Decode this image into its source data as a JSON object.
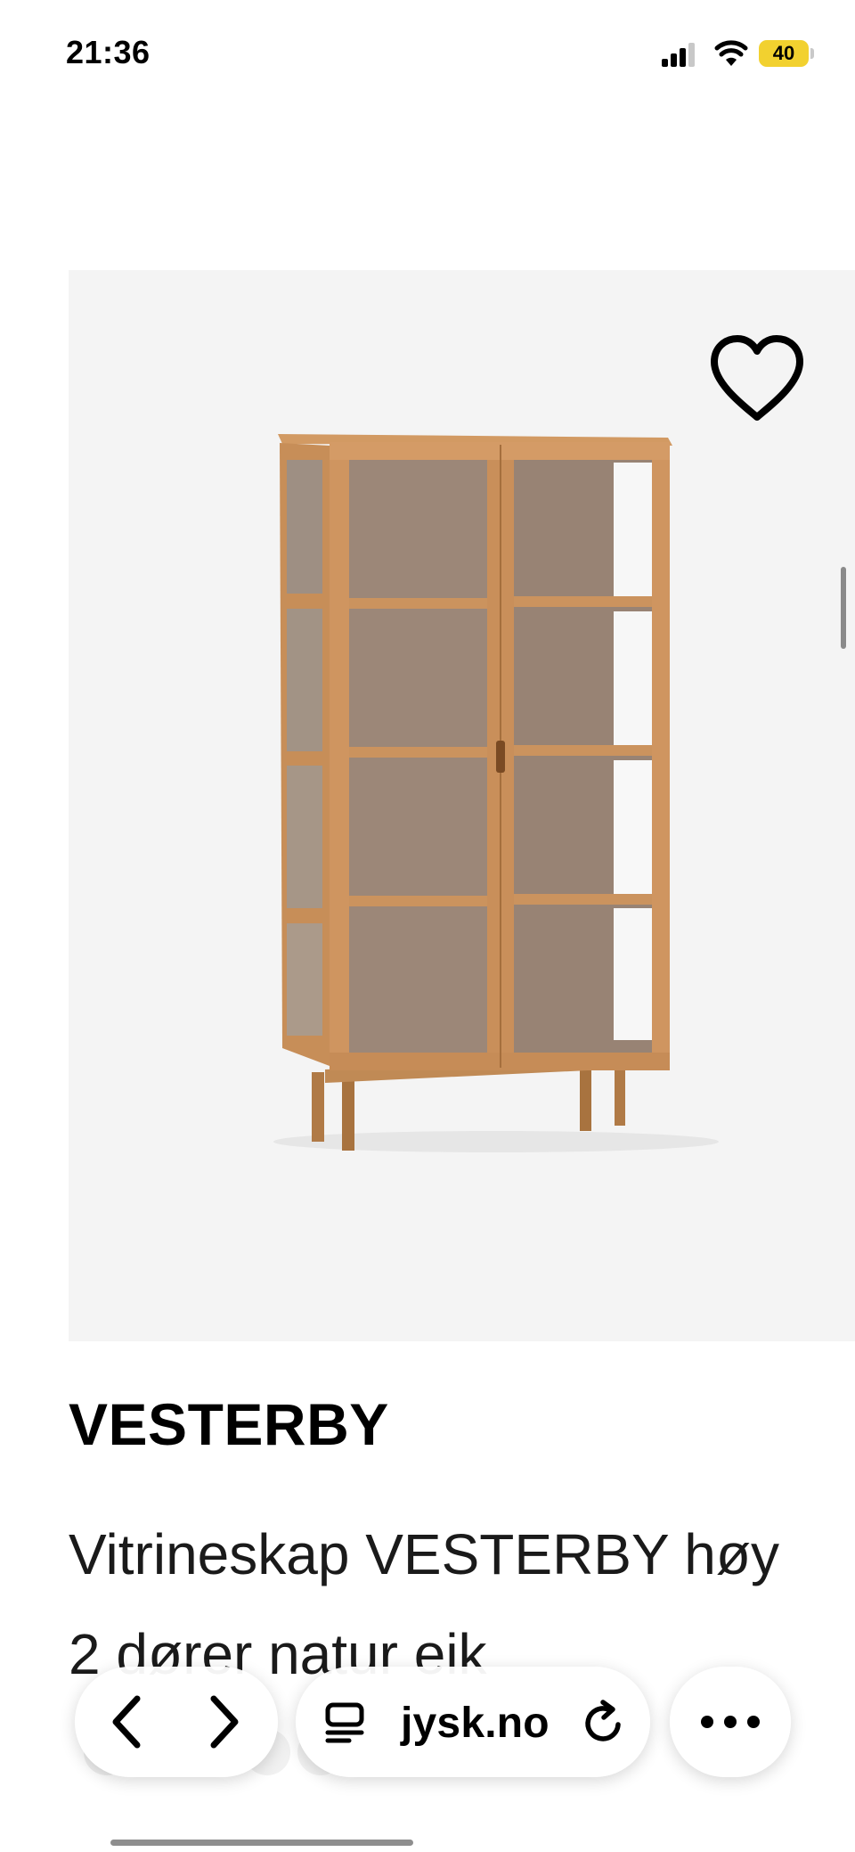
{
  "status_bar": {
    "time": "21:36",
    "battery_level": "40",
    "battery_color": "#f2d12f",
    "icons": [
      "signal-icon",
      "wifi-icon",
      "battery-icon"
    ]
  },
  "product": {
    "brand": "VESTERBY",
    "title_line1": "Vitrineskap VESTERBY høy",
    "title_line2": "2 dører natur eik",
    "image_background": "#f4f4f4",
    "favorite_icon": "heart-outline-icon"
  },
  "browser_toolbar": {
    "url": "jysk.no",
    "back_icon": "chevron-left-icon",
    "forward_icon": "chevron-right-icon",
    "reader_icon": "reader-mode-icon",
    "reload_icon": "reload-icon",
    "more_icon": "more-dots-icon"
  }
}
